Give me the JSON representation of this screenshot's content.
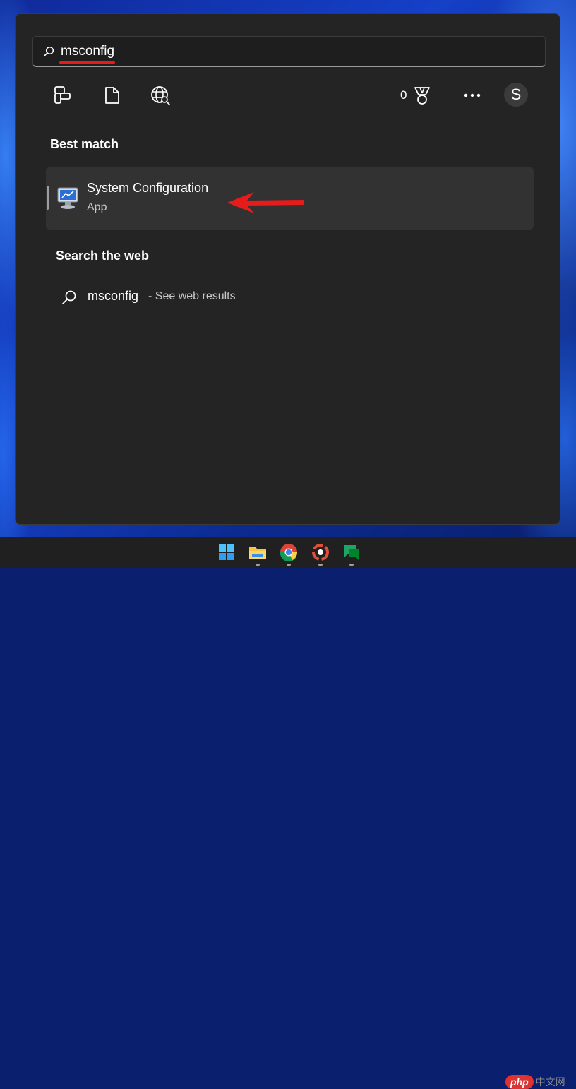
{
  "search": {
    "query": "msconfig"
  },
  "toolbar": {
    "icons": [
      "apps-icon",
      "document-icon",
      "web-globe-icon"
    ],
    "points_count": "0",
    "points_icon": "rewards-medal-icon",
    "more_icon": "more-options-icon",
    "avatar_letter": "S"
  },
  "best_match": {
    "section_title": "Best match",
    "title": "System Configuration",
    "type": "App",
    "icon": "system-configuration-icon"
  },
  "web": {
    "section_title": "Search the web",
    "query": "msconfig",
    "suffix": "- See web results",
    "icon": "search-icon"
  },
  "taskbar": {
    "apps": [
      "start-icon",
      "file-explorer-icon",
      "chrome-icon",
      "photos-icon",
      "chat-icon"
    ]
  },
  "watermark": {
    "brand": "php",
    "site": "中文网"
  },
  "colors": {
    "panel": "#242424",
    "highlight": "#323232",
    "annotation_red": "#e81b1b",
    "taskbar": "#202020"
  }
}
